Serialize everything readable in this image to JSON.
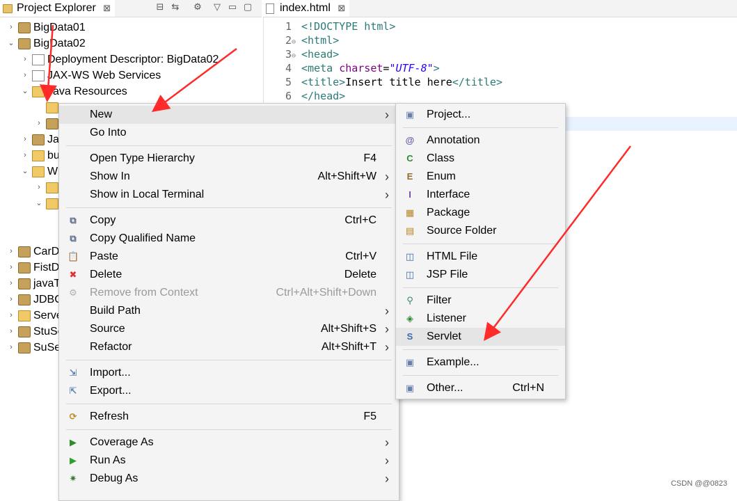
{
  "explorer": {
    "tab_label": "Project Explorer",
    "tab_close": "⊠",
    "tree": [
      {
        "label": "BigData01",
        "indent": 0,
        "twisty": "›",
        "icon": "project"
      },
      {
        "label": "BigData02",
        "indent": 0,
        "twisty": "⌄",
        "icon": "project"
      },
      {
        "label": "Deployment Descriptor: BigData02",
        "indent": 1,
        "twisty": "›",
        "icon": "descriptor"
      },
      {
        "label": "JAX-WS Web Services",
        "indent": 1,
        "twisty": "›",
        "icon": "webservice"
      },
      {
        "label": "Java Resources",
        "indent": 1,
        "twisty": "⌄",
        "icon": "folder"
      },
      {
        "label": "",
        "indent": 2,
        "twisty": "",
        "icon": "package"
      },
      {
        "label": "",
        "indent": 2,
        "twisty": "›",
        "icon": "library"
      },
      {
        "label": "Ja",
        "indent": 1,
        "twisty": "›",
        "icon": "library"
      },
      {
        "label": "bu",
        "indent": 1,
        "twisty": "›",
        "icon": "folder"
      },
      {
        "label": "W",
        "indent": 1,
        "twisty": "⌄",
        "icon": "folder"
      },
      {
        "label": "",
        "indent": 2,
        "twisty": "›",
        "icon": "folder"
      },
      {
        "label": "",
        "indent": 2,
        "twisty": "⌄",
        "icon": "folder"
      },
      {
        "label": "",
        "indent": 3,
        "twisty": "",
        "icon": "file"
      },
      {
        "label": "CarD",
        "indent": 0,
        "twisty": "›",
        "icon": "project"
      },
      {
        "label": "FistD",
        "indent": 0,
        "twisty": "›",
        "icon": "project"
      },
      {
        "label": "javaT",
        "indent": 0,
        "twisty": "›",
        "icon": "project"
      },
      {
        "label": "JDBC",
        "indent": 0,
        "twisty": "›",
        "icon": "project"
      },
      {
        "label": "Serve",
        "indent": 0,
        "twisty": "›",
        "icon": "folder"
      },
      {
        "label": "StuSe",
        "indent": 0,
        "twisty": "›",
        "icon": "project"
      },
      {
        "label": "SuSe",
        "indent": 0,
        "twisty": "›",
        "icon": "project"
      }
    ]
  },
  "editor": {
    "tab_label": "index.html",
    "tab_close": "⊠",
    "lines": [
      {
        "num": "1",
        "fold": "",
        "parts": [
          {
            "t": "<!DOCTYPE html>",
            "c": "tag"
          }
        ]
      },
      {
        "num": "2",
        "fold": "⊖",
        "parts": [
          {
            "t": "<html>",
            "c": "tag"
          }
        ]
      },
      {
        "num": "3",
        "fold": "⊖",
        "parts": [
          {
            "t": "<head>",
            "c": "tag"
          }
        ]
      },
      {
        "num": "4",
        "fold": "",
        "parts": [
          {
            "t": "<meta ",
            "c": "tag"
          },
          {
            "t": "charset",
            "c": "attr"
          },
          {
            "t": "=",
            "c": ""
          },
          {
            "t": "\"UTF-8\"",
            "c": "str"
          },
          {
            "t": ">",
            "c": "tag"
          }
        ]
      },
      {
        "num": "5",
        "fold": "",
        "parts": [
          {
            "t": "<title>",
            "c": "tag"
          },
          {
            "t": "Insert title here",
            "c": ""
          },
          {
            "t": "</title>",
            "c": "tag"
          }
        ]
      },
      {
        "num": "6",
        "fold": "",
        "parts": [
          {
            "t": "</head>",
            "c": "tag"
          }
        ]
      }
    ]
  },
  "context_menu": {
    "items": [
      {
        "type": "item",
        "label": "New",
        "shortcut": "",
        "submenu": true,
        "icon": "",
        "disabled": false,
        "hover": true
      },
      {
        "type": "item",
        "label": "Go Into",
        "shortcut": "",
        "submenu": false,
        "icon": "",
        "disabled": false
      },
      {
        "type": "sep"
      },
      {
        "type": "item",
        "label": "Open Type Hierarchy",
        "shortcut": "F4",
        "submenu": false,
        "icon": "",
        "disabled": false
      },
      {
        "type": "item",
        "label": "Show In",
        "shortcut": "Alt+Shift+W",
        "submenu": true,
        "icon": "",
        "disabled": false
      },
      {
        "type": "item",
        "label": "Show in Local Terminal",
        "shortcut": "",
        "submenu": true,
        "icon": "",
        "disabled": false
      },
      {
        "type": "sep"
      },
      {
        "type": "item",
        "label": "Copy",
        "shortcut": "Ctrl+C",
        "submenu": false,
        "icon": "copy-icon",
        "disabled": false
      },
      {
        "type": "item",
        "label": "Copy Qualified Name",
        "shortcut": "",
        "submenu": false,
        "icon": "copy-qualified-icon",
        "disabled": false
      },
      {
        "type": "item",
        "label": "Paste",
        "shortcut": "Ctrl+V",
        "submenu": false,
        "icon": "paste-icon",
        "disabled": false
      },
      {
        "type": "item",
        "label": "Delete",
        "shortcut": "Delete",
        "submenu": false,
        "icon": "delete-icon",
        "disabled": false
      },
      {
        "type": "item",
        "label": "Remove from Context",
        "shortcut": "Ctrl+Alt+Shift+Down",
        "submenu": false,
        "icon": "remove-context-icon",
        "disabled": true
      },
      {
        "type": "item",
        "label": "Build Path",
        "shortcut": "",
        "submenu": true,
        "icon": "",
        "disabled": false
      },
      {
        "type": "item",
        "label": "Source",
        "shortcut": "Alt+Shift+S",
        "submenu": true,
        "icon": "",
        "disabled": false
      },
      {
        "type": "item",
        "label": "Refactor",
        "shortcut": "Alt+Shift+T",
        "submenu": true,
        "icon": "",
        "disabled": false
      },
      {
        "type": "sep"
      },
      {
        "type": "item",
        "label": "Import...",
        "shortcut": "",
        "submenu": false,
        "icon": "import-icon",
        "disabled": false
      },
      {
        "type": "item",
        "label": "Export...",
        "shortcut": "",
        "submenu": false,
        "icon": "export-icon",
        "disabled": false
      },
      {
        "type": "sep"
      },
      {
        "type": "item",
        "label": "Refresh",
        "shortcut": "F5",
        "submenu": false,
        "icon": "refresh-icon",
        "disabled": false
      },
      {
        "type": "sep"
      },
      {
        "type": "item",
        "label": "Coverage As",
        "shortcut": "",
        "submenu": true,
        "icon": "coverage-icon",
        "disabled": false
      },
      {
        "type": "item",
        "label": "Run As",
        "shortcut": "",
        "submenu": true,
        "icon": "run-icon",
        "disabled": false
      },
      {
        "type": "item",
        "label": "Debug As",
        "shortcut": "",
        "submenu": true,
        "icon": "debug-icon",
        "disabled": false
      }
    ]
  },
  "new_submenu": {
    "items": [
      {
        "type": "item",
        "label": "Project...",
        "shortcut": "",
        "icon": "project-icon"
      },
      {
        "type": "sep"
      },
      {
        "type": "item",
        "label": "Annotation",
        "shortcut": "",
        "icon": "annotation-icon"
      },
      {
        "type": "item",
        "label": "Class",
        "shortcut": "",
        "icon": "class-icon"
      },
      {
        "type": "item",
        "label": "Enum",
        "shortcut": "",
        "icon": "enum-icon"
      },
      {
        "type": "item",
        "label": "Interface",
        "shortcut": "",
        "icon": "interface-icon"
      },
      {
        "type": "item",
        "label": "Package",
        "shortcut": "",
        "icon": "package-icon"
      },
      {
        "type": "item",
        "label": "Source Folder",
        "shortcut": "",
        "icon": "source-folder-icon"
      },
      {
        "type": "sep"
      },
      {
        "type": "item",
        "label": "HTML File",
        "shortcut": "",
        "icon": "html-file-icon"
      },
      {
        "type": "item",
        "label": "JSP File",
        "shortcut": "",
        "icon": "jsp-file-icon"
      },
      {
        "type": "sep"
      },
      {
        "type": "item",
        "label": "Filter",
        "shortcut": "",
        "icon": "filter-icon"
      },
      {
        "type": "item",
        "label": "Listener",
        "shortcut": "",
        "icon": "listener-icon"
      },
      {
        "type": "item",
        "label": "Servlet",
        "shortcut": "",
        "icon": "servlet-icon",
        "hover": true
      },
      {
        "type": "sep"
      },
      {
        "type": "item",
        "label": "Example...",
        "shortcut": "",
        "icon": "example-icon"
      },
      {
        "type": "sep"
      },
      {
        "type": "item",
        "label": "Other...",
        "shortcut": "Ctrl+N",
        "icon": "other-icon"
      }
    ]
  },
  "colors": {
    "arrow": "#ff2a2a",
    "hover": "#e5e5e5",
    "menu_bg": "#f4f4f4"
  },
  "watermark": "CSDN @@0823"
}
